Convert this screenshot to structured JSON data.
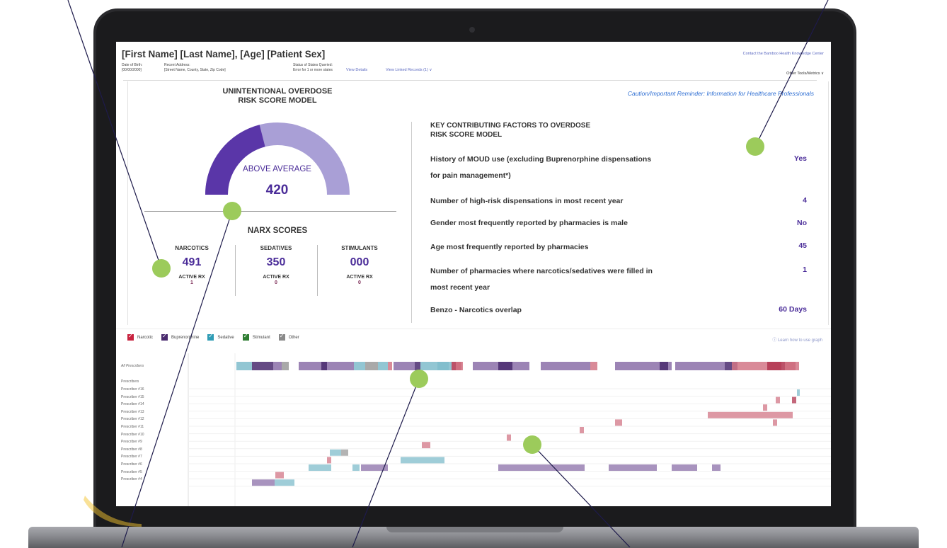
{
  "header": {
    "patient_name": "[First Name] [Last Name], [Age] [Patient Sex]",
    "contact_link": "Contact the Bamboo Health Knowledge Center",
    "dob_label": "Date of Birth:",
    "dob_value": "[00/00/2000]",
    "address_label": "Recent Address:",
    "address_value": "[Street Name, County, State, Zip Code]",
    "status_label": "Status of States Queried:",
    "status_value": "Error for 1 or more states",
    "view_details": "View Details",
    "view_linked": "View Linked Records (1) ∨",
    "other_tools": "Other Tools/Metrics ∨"
  },
  "risk": {
    "title_line1": "UNINTENTIONAL OVERDOSE",
    "title_line2": "RISK SCORE MODEL",
    "gauge_label": "ABOVE AVERAGE",
    "score": "420",
    "gauge_fill_fraction": 0.42,
    "colors": {
      "fill": "#5a36a8",
      "track": "#a99fd6"
    }
  },
  "narx": {
    "title": "NARX SCORES",
    "active_label": "ACTIVE RX",
    "columns": [
      {
        "name": "NARCOTICS",
        "score": "491",
        "active": "1"
      },
      {
        "name": "SEDATIVES",
        "score": "350",
        "active": "0"
      },
      {
        "name": "STIMULANTS",
        "score": "000",
        "active": "0"
      }
    ]
  },
  "factors": {
    "caution": "Caution/Important Reminder: Information for Healthcare Professionals",
    "title_line1": "KEY CONTRIBUTING FACTORS TO OVERDOSE",
    "title_line2": "RISK SCORE MODEL",
    "items": [
      {
        "line1": "History of MOUD use (excluding Buprenorphine dispensations",
        "line2": "for pain management*)",
        "value": "Yes"
      },
      {
        "line1": "Number of high-risk dispensations in most recent year",
        "line2": "",
        "value": "4"
      },
      {
        "line1": "Gender most frequently reported by pharmacies is male",
        "line2": "",
        "value": "No"
      },
      {
        "line1": "Age most frequently reported by pharmacies",
        "line2": "",
        "value": "45"
      },
      {
        "line1": "Number of pharmacies where narcotics/sedatives were filled in",
        "line2": "most recent year",
        "value": "1"
      },
      {
        "line1": "Benzo - Narcotics overlap",
        "line2": "",
        "value": "60 Days"
      }
    ]
  },
  "chart": {
    "legend": [
      {
        "label": "Narcotic",
        "color": "#c8233f"
      },
      {
        "label": "Buprenorphine",
        "color": "#4a2a6e"
      },
      {
        "label": "Sedative",
        "color": "#2f9cb5"
      },
      {
        "label": "Stimulant",
        "color": "#2e7d32"
      },
      {
        "label": "Other",
        "color": "#8a8a8a"
      }
    ],
    "learn_link": "Learn how to use graph",
    "all_prescribers": "All Prescribers",
    "prescribers_header": "Prescribers",
    "rows": [
      "Prescriber #16",
      "Prescriber #15",
      "Prescriber #14",
      "Prescriber #13",
      "Prescriber #12",
      "Prescriber #11",
      "Prescriber #10",
      "Prescriber #9",
      "Prescriber #8",
      "Prescriber #7",
      "Prescriber #6",
      "Prescriber #5",
      "Prescriber #4"
    ]
  }
}
